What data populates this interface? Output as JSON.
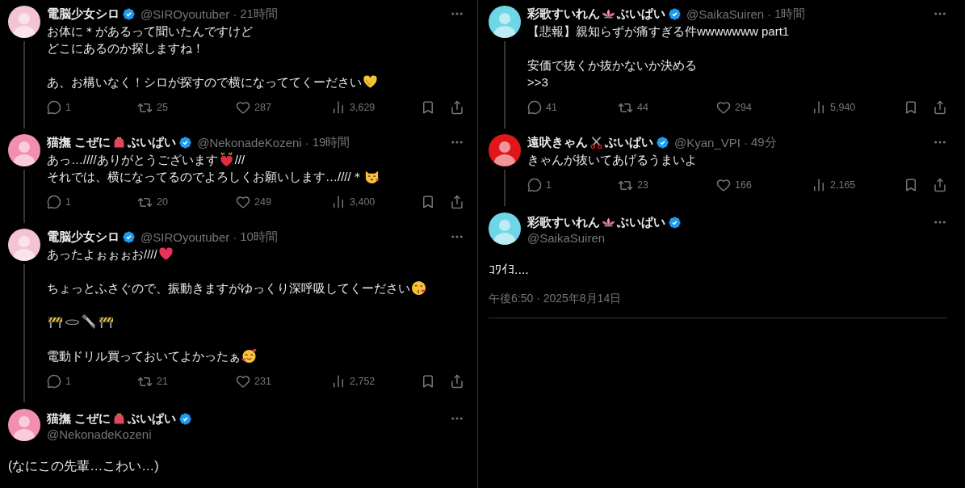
{
  "columns": [
    {
      "tweets": [
        {
          "kind": "reply",
          "thread_line": true,
          "author": {
            "name": [
              {
                "kind": "text",
                "text": "電脳少女シロ"
              }
            ],
            "handle": "@SIROyoutuber",
            "color": "#f3c4d6"
          },
          "dot": "·",
          "time": "21時間",
          "body": [
            {
              "lines": [
                [
                  {
                    "kind": "text",
                    "text": "お体に＊があるって聞いたんですけど"
                  }
                ],
                [
                  {
                    "kind": "text",
                    "text": "どこにあるのか探しますね！"
                  }
                ]
              ]
            },
            {
              "lines": [
                [
                  {
                    "kind": "text",
                    "text": "あ、お構いなく！シロが探すので横になっててくーださい"
                  },
                  {
                    "kind": "heart_hands"
                  }
                ]
              ]
            }
          ],
          "stats": {
            "replies": "1",
            "reposts": "25",
            "likes": "287",
            "views": "3,629"
          }
        },
        {
          "kind": "reply",
          "thread_line": true,
          "author": {
            "name": [
              {
                "kind": "text",
                "text": "猫撫 こぜに"
              },
              {
                "kind": "purse"
              },
              {
                "kind": "text",
                "text": "ぶいぱい"
              }
            ],
            "handle": "@NekonadeKozeni",
            "color": "#f28fb0"
          },
          "dot": "·",
          "time": "19時間",
          "body": [
            {
              "lines": [
                [
                  {
                    "kind": "text",
                    "text": "あっ…////ありがとうございます"
                  },
                  {
                    "kind": "heart_sparkle"
                  },
                  {
                    "kind": "text",
                    "text": "///"
                  }
                ],
                [
                  {
                    "kind": "text",
                    "text": "それでは、横になってるのでよろしくお願いします…////＊"
                  },
                  {
                    "kind": "kissing_cat"
                  }
                ]
              ]
            }
          ],
          "stats": {
            "replies": "1",
            "reposts": "20",
            "likes": "249",
            "views": "3,400"
          }
        },
        {
          "kind": "reply",
          "thread_line": true,
          "author": {
            "name": [
              {
                "kind": "text",
                "text": "電脳少女シロ"
              }
            ],
            "handle": "@SIROyoutuber",
            "color": "#f3c4d6"
          },
          "dot": "·",
          "time": "10時間",
          "body": [
            {
              "lines": [
                [
                  {
                    "kind": "text",
                    "text": "あったよぉぉぉお////"
                  },
                  {
                    "kind": "red_heart"
                  }
                ]
              ]
            },
            {
              "lines": [
                [
                  {
                    "kind": "text",
                    "text": "ちょっとふさぐので、振動きますがゆっくり深呼吸してくーださい"
                  },
                  {
                    "kind": "kiss_face"
                  }
                ]
              ]
            },
            {
              "lines": [
                [
                  {
                    "kind": "barrier"
                  },
                  {
                    "kind": "hole"
                  },
                  {
                    "kind": "bolt"
                  },
                  {
                    "kind": "barrier"
                  }
                ]
              ]
            },
            {
              "lines": [
                [
                  {
                    "kind": "text",
                    "text": "電動ドリル買っておいてよかったぁ"
                  },
                  {
                    "kind": "love_face"
                  }
                ]
              ]
            }
          ],
          "stats": {
            "replies": "1",
            "reposts": "21",
            "likes": "231",
            "views": "2,752"
          }
        },
        {
          "kind": "main",
          "author": {
            "name": [
              {
                "kind": "text",
                "text": "猫撫 こぜに"
              },
              {
                "kind": "purse"
              },
              {
                "kind": "text",
                "text": "ぶいぱい"
              }
            ],
            "handle": "@NekonadeKozeni",
            "color": "#f28fb0"
          },
          "body": [
            {
              "lines": [
                [
                  {
                    "kind": "text",
                    "text": "(なにこの先輩…こわい…)"
                  }
                ]
              ]
            }
          ]
        }
      ]
    },
    {
      "tweets": [
        {
          "kind": "reply",
          "thread_line": true,
          "author": {
            "name": [
              {
                "kind": "text",
                "text": "彩歌すいれん"
              },
              {
                "kind": "lotus"
              },
              {
                "kind": "text",
                "text": "ぶいぱい"
              }
            ],
            "handle": "@SaikaSuiren",
            "color": "#6fd6e8"
          },
          "dot": "·",
          "time": "1時間",
          "body": [
            {
              "lines": [
                [
                  {
                    "kind": "text",
                    "text": "【悲報】親知らずが痛すぎる件wwwwwww part1"
                  }
                ]
              ]
            },
            {
              "lines": [
                [
                  {
                    "kind": "text",
                    "text": "安価で抜くか抜かないか決める"
                  }
                ],
                [
                  {
                    "kind": "text",
                    "text": ">>3"
                  }
                ]
              ]
            }
          ],
          "stats": {
            "replies": "41",
            "reposts": "44",
            "likes": "294",
            "views": "5,940"
          }
        },
        {
          "kind": "reply",
          "thread_line": true,
          "author": {
            "name": [
              {
                "kind": "text",
                "text": "遠吠きゃん"
              },
              {
                "kind": "scissors"
              },
              {
                "kind": "text",
                "text": "ぶいぱい"
              }
            ],
            "handle": "@Kyan_VPI",
            "color": "#e0161b"
          },
          "dot": "·",
          "time": "49分",
          "body": [
            {
              "lines": [
                [
                  {
                    "kind": "text",
                    "text": "きゃんが抜いてあげるうまいよ"
                  }
                ]
              ]
            }
          ],
          "stats": {
            "replies": "1",
            "reposts": "23",
            "likes": "166",
            "views": "2,165"
          }
        },
        {
          "kind": "main",
          "author": {
            "name": [
              {
                "kind": "text",
                "text": "彩歌すいれん"
              },
              {
                "kind": "lotus"
              },
              {
                "kind": "text",
                "text": "ぶいぱい"
              }
            ],
            "handle": "@SaikaSuiren",
            "color": "#6fd6e8"
          },
          "body": [
            {
              "lines": [
                [
                  {
                    "kind": "text",
                    "text": "ｺﾜｲﾖ...."
                  }
                ]
              ]
            }
          ],
          "timestamp": "午後6:50 · 2025年8月14日"
        }
      ]
    }
  ]
}
